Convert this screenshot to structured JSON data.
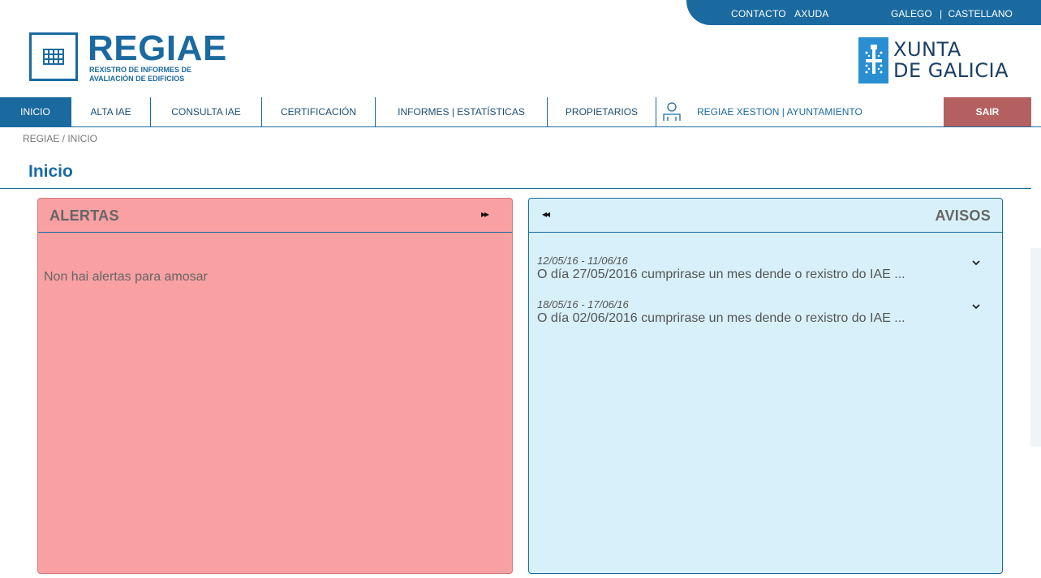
{
  "topbar": {
    "contact": "CONTACTO",
    "help": "AXUDA",
    "lang_gl": "GALEGO",
    "separator": "|",
    "lang_es": "CASTELLANO"
  },
  "logo": {
    "title": "REGIAE",
    "subtitle_line1": "REXISTRO DE INFORMES DE",
    "subtitle_line2": "AVALIACIÓN DE EDIFICIOS"
  },
  "xunta": {
    "line1": "XUNTA",
    "line2": "DE GALICIA"
  },
  "nav": {
    "items": [
      {
        "label": "INICIO"
      },
      {
        "label": "ALTA IAE"
      },
      {
        "label": "CONSULTA IAE"
      },
      {
        "label": "CERTIFICACIÓN"
      },
      {
        "label": "INFORMES | ESTATÍSTICAS"
      },
      {
        "label": "PROPIETARIOS"
      }
    ],
    "user": "REGIAE XESTION | AYUNTAMIENTO",
    "logout": "SAIR"
  },
  "breadcrumb": "REGIAE / INICIO",
  "page_title": "Inicio",
  "alerts": {
    "title": "ALERTAS",
    "forward_icon": "▸▸",
    "empty": "Non hai alertas para amosar"
  },
  "notices": {
    "title": "AVISOS",
    "back_icon": "◂◂",
    "items": [
      {
        "date": "12/05/16 - 11/06/16",
        "text": "O día 27/05/2016 cumprirase un mes dende o rexistro do IAE ..."
      },
      {
        "date": "18/05/16 - 17/06/16",
        "text": "O día 02/06/2016 cumprirase un mes dende o rexistro do IAE ..."
      }
    ]
  },
  "colors": {
    "brand": "#1a6aa0",
    "alerts_bg": "#f8a0a2",
    "notices_bg": "#d7f0f9",
    "logout_bg": "#b46060"
  }
}
